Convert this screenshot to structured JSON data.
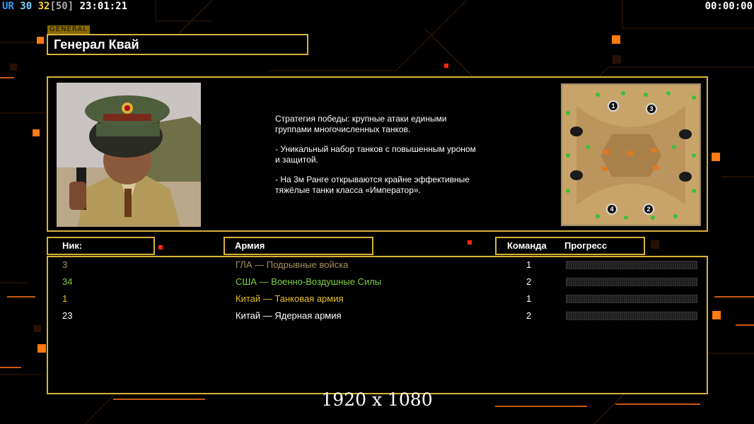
{
  "hud": {
    "tag1": "UR",
    "val1": "30",
    "val2": "32",
    "val3": "[50]",
    "clock": "23:01:21",
    "timer": "00:00:00",
    "colors": {
      "tag1": "#3aa0ff",
      "val1": "#7fd0ff",
      "val2": "#ffd23a",
      "val3": "#aaaaaa",
      "clock": "#ffffff"
    }
  },
  "general": {
    "tag": "GENERAL",
    "name": "Генерал Квай",
    "portrait_icon": "general-portrait",
    "description": [
      "Стратегия победы: крупные атаки едиными\n группами многочисленных танков.",
      "- Уникальный набор танков с повышенным уроном\n и защитой.",
      "- На 3м Ранге открываются крайне эффективные\n тяжёлые танки класса «Император»."
    ]
  },
  "map": {
    "icon": "map-preview",
    "starts": [
      "1",
      "2",
      "3",
      "4"
    ]
  },
  "table": {
    "headers": {
      "nick": "Ник:",
      "army": "Армия",
      "team": "Команда",
      "progress": "Прогресс"
    },
    "rows": [
      {
        "nick": "3",
        "army": "ГЛА — Подрывные войска",
        "team": "1",
        "color": "#a89060",
        "progress": 0
      },
      {
        "nick": "34",
        "army": "США — Военно-Воздушные Силы",
        "team": "2",
        "color": "#7fd040",
        "progress": 0
      },
      {
        "nick": "1",
        "army": "Китай — Танковая армия",
        "team": "1",
        "color": "#e8c020",
        "progress": 0
      },
      {
        "nick": "23",
        "army": "Китай — Ядерная армия",
        "team": "2",
        "color": "#ffffff",
        "progress": 0
      }
    ]
  },
  "resolution": "1920 x 1080",
  "colors": {
    "accent": "#d8b23a",
    "orange": "#ff7a10",
    "red": "#ff2a10"
  }
}
